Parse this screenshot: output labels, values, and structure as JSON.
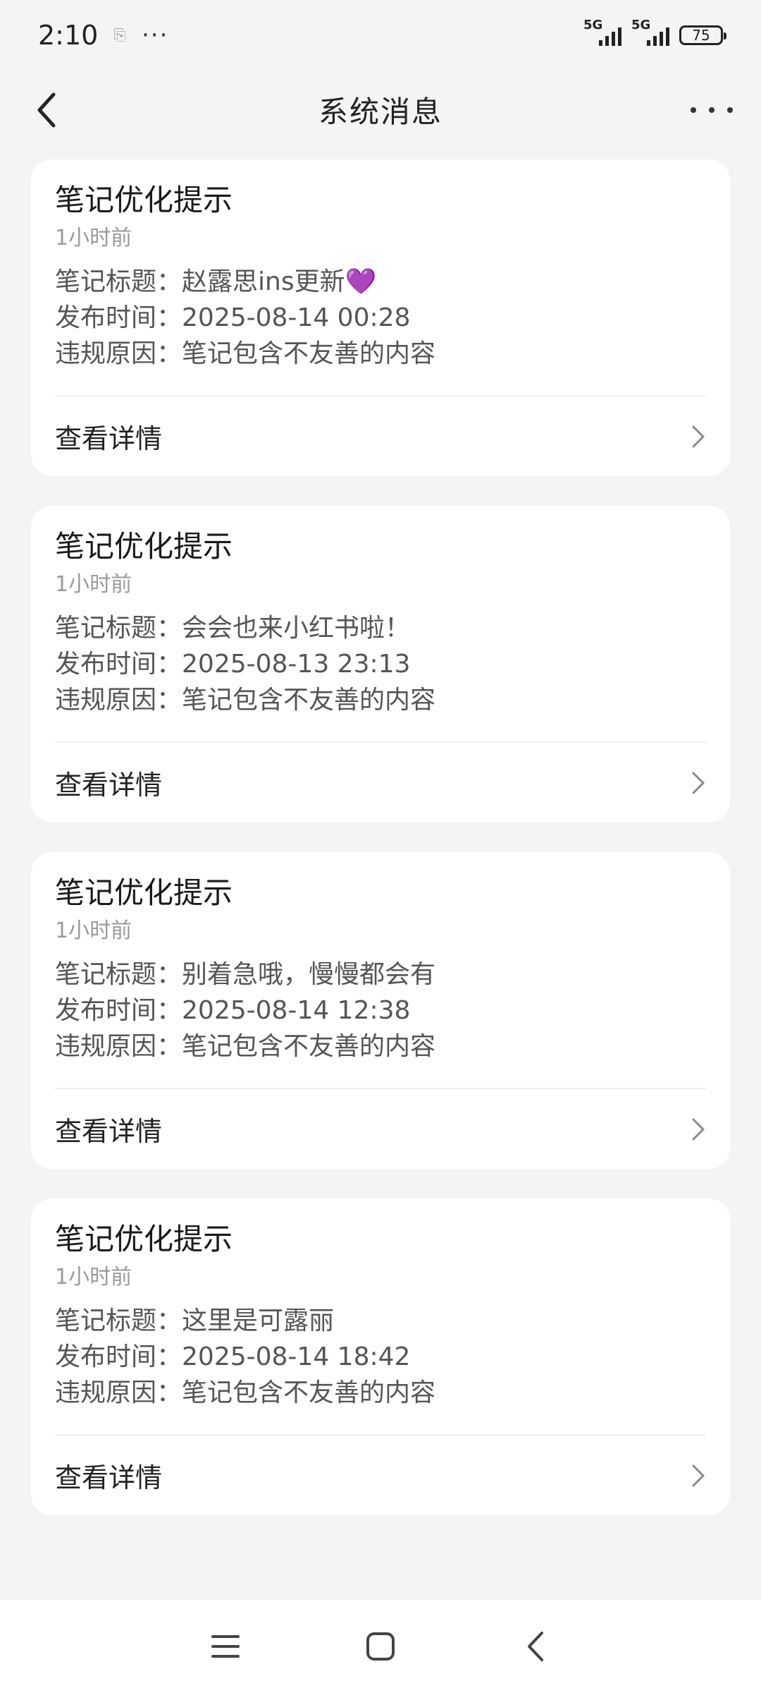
{
  "status_bar": {
    "time": "2:10",
    "notification_icon": "app-badge-icon",
    "more_dots": "···",
    "signal1_label": "5G",
    "signal2_label": "5G",
    "battery": "75"
  },
  "header": {
    "title": "系统消息",
    "back_icon": "chevron-left-icon",
    "more_icon": "more-horizontal-icon"
  },
  "cards": [
    {
      "title": "笔记优化提示",
      "time": "1小时前",
      "note_title_label": "笔记标题：",
      "note_title": "赵露思ins更新💜",
      "publish_label": "发布时间：",
      "publish_time": "2025-08-14 00:28",
      "reason_label": "违规原因：",
      "reason": "笔记包含不友善的内容",
      "detail": "查看详情"
    },
    {
      "title": "笔记优化提示",
      "time": "1小时前",
      "note_title_label": "笔记标题：",
      "note_title": "会会也来小红书啦！",
      "publish_label": "发布时间：",
      "publish_time": "2025-08-13 23:13",
      "reason_label": "违规原因：",
      "reason": "笔记包含不友善的内容",
      "detail": "查看详情"
    },
    {
      "title": "笔记优化提示",
      "time": "1小时前",
      "note_title_label": "笔记标题：",
      "note_title": "别着急哦，慢慢都会有",
      "publish_label": "发布时间：",
      "publish_time": "2025-08-14 12:38",
      "reason_label": "违规原因：",
      "reason": "笔记包含不友善的内容",
      "detail": "查看详情"
    },
    {
      "title": "笔记优化提示",
      "time": "1小时前",
      "note_title_label": "笔记标题：",
      "note_title": "这里是可露丽",
      "publish_label": "发布时间：",
      "publish_time": "2025-08-14 18:42",
      "reason_label": "违规原因：",
      "reason": "笔记包含不友善的内容",
      "detail": "查看详情"
    }
  ],
  "system_nav": {
    "menu_icon": "menu-icon",
    "home_icon": "home-square-icon",
    "back_icon": "back-triangle-icon"
  }
}
